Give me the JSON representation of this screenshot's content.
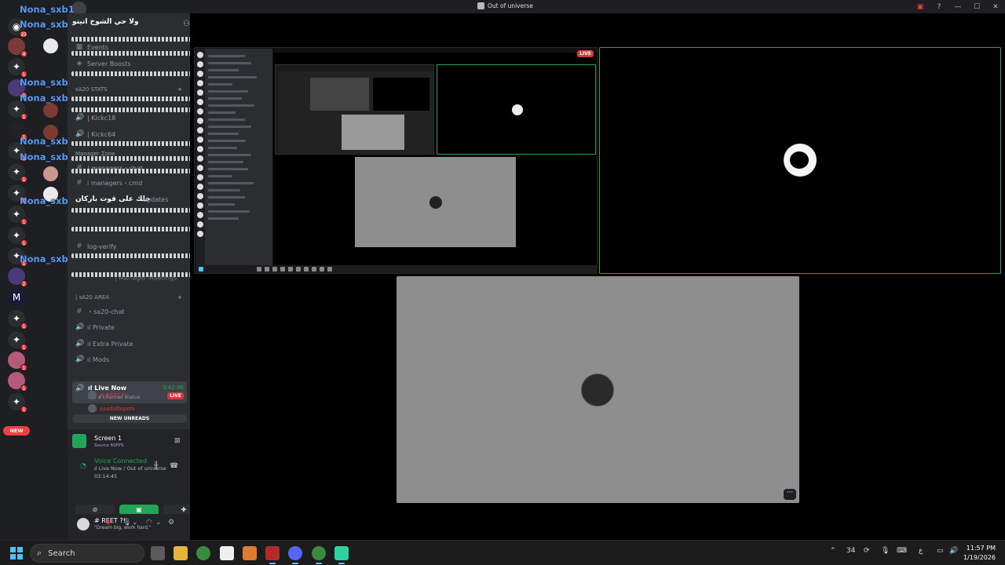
{
  "window": {
    "title": "Out of universe"
  },
  "rail": {
    "overlay_names": [
      "Nona_sxb1",
      "Nona_sxb1",
      "Nona_sxb1",
      "Nona_sxb1",
      "Nona_sxb1",
      "Nona_sxb1",
      "Nona_sxb1",
      "Nona_sxb1"
    ],
    "badges": [
      "23",
      "4",
      "1",
      "1",
      "1",
      "1",
      "1",
      "1",
      "1",
      "1",
      "1",
      "1",
      "2",
      "1",
      "1",
      "1",
      "1",
      "1",
      "1"
    ],
    "new_label": "NEW"
  },
  "sidebar": {
    "guild_name": "ولا حي الشوخ اتيتو",
    "overlay_text_1": "خلك على قوت باركان",
    "channels": {
      "events": "Events",
      "boosts": "Server Boosts",
      "cat_stats": "sA20 STATS",
      "kick1": "| Kickc18",
      "kick2": "| Kickc64",
      "cat_manager": "Manager Zone",
      "managers_chat": "| managers・chat",
      "managers_cmd": "i managers・cmd",
      "updates": "updates",
      "log_verify": "log-verify",
      "manager_meetings": "| Manager Meetings",
      "cat_area": "| sA20 AREA",
      "sa20_chat": "・sa20-chat",
      "private": "ıl Private",
      "extra_private": "ıl Extra Private",
      "mods": "ıl Mods"
    },
    "live_channel": {
      "name": "ıl Live Now",
      "timer": "3:42:06",
      "status": "Set a channel status"
    },
    "voice_users": [
      {
        "name": "# REET ?!",
        "live": "LIVE"
      },
      {
        "name": "saadalbqami"
      }
    ],
    "new_unreads": "NEW UNREADS"
  },
  "panel": {
    "stream_title": "Screen 1",
    "stream_quality": "Source 60FPS",
    "voice_status": "Voice Connected",
    "voice_channel": "ıl Live Now / Out of universe",
    "voice_time": "03:14:45"
  },
  "user": {
    "name": "# REET ?!",
    "status": "\"Dream big, work hard.\""
  },
  "stage": {
    "live_label": "LIVE",
    "more": "···"
  },
  "taskbar": {
    "search": "Search",
    "tray_count": "34",
    "lang": "ع",
    "time": "11:57 PM",
    "date": "1/19/2026"
  },
  "colors": {
    "accent_green": "#23a559",
    "live_red": "#da373c",
    "link_blue": "#5b9bf5",
    "bg_dark": "#1e1f22",
    "sidebar": "#2b2d31"
  }
}
